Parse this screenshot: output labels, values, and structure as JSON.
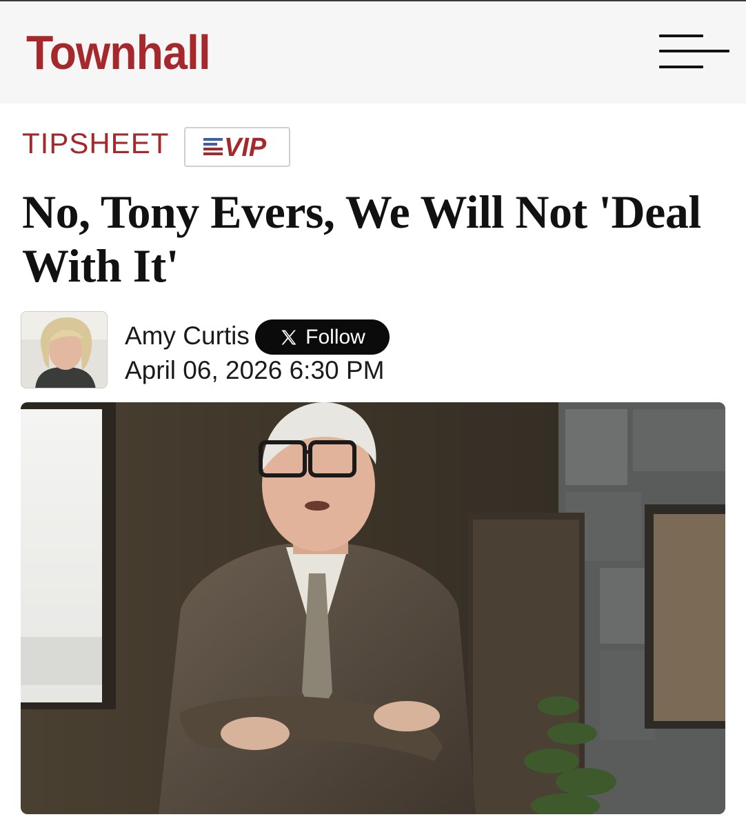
{
  "header": {
    "logo_text": "Townhall",
    "menu_icon": "hamburger-menu-icon",
    "brand_color": "#a4282c"
  },
  "article": {
    "category": "TIPSHEET",
    "vip_badge": {
      "label": "VIP",
      "icon": "american-flag-icon"
    },
    "headline": "No, Tony Evers, We Will Not 'Deal With It'",
    "author": {
      "name": "Amy Curtis",
      "follow_label": "Follow",
      "follow_icon": "x-logo-icon"
    },
    "published": "April 06, 2026 6:30 PM",
    "hero_image": "photo-man-in-suit-arms-crossed"
  }
}
